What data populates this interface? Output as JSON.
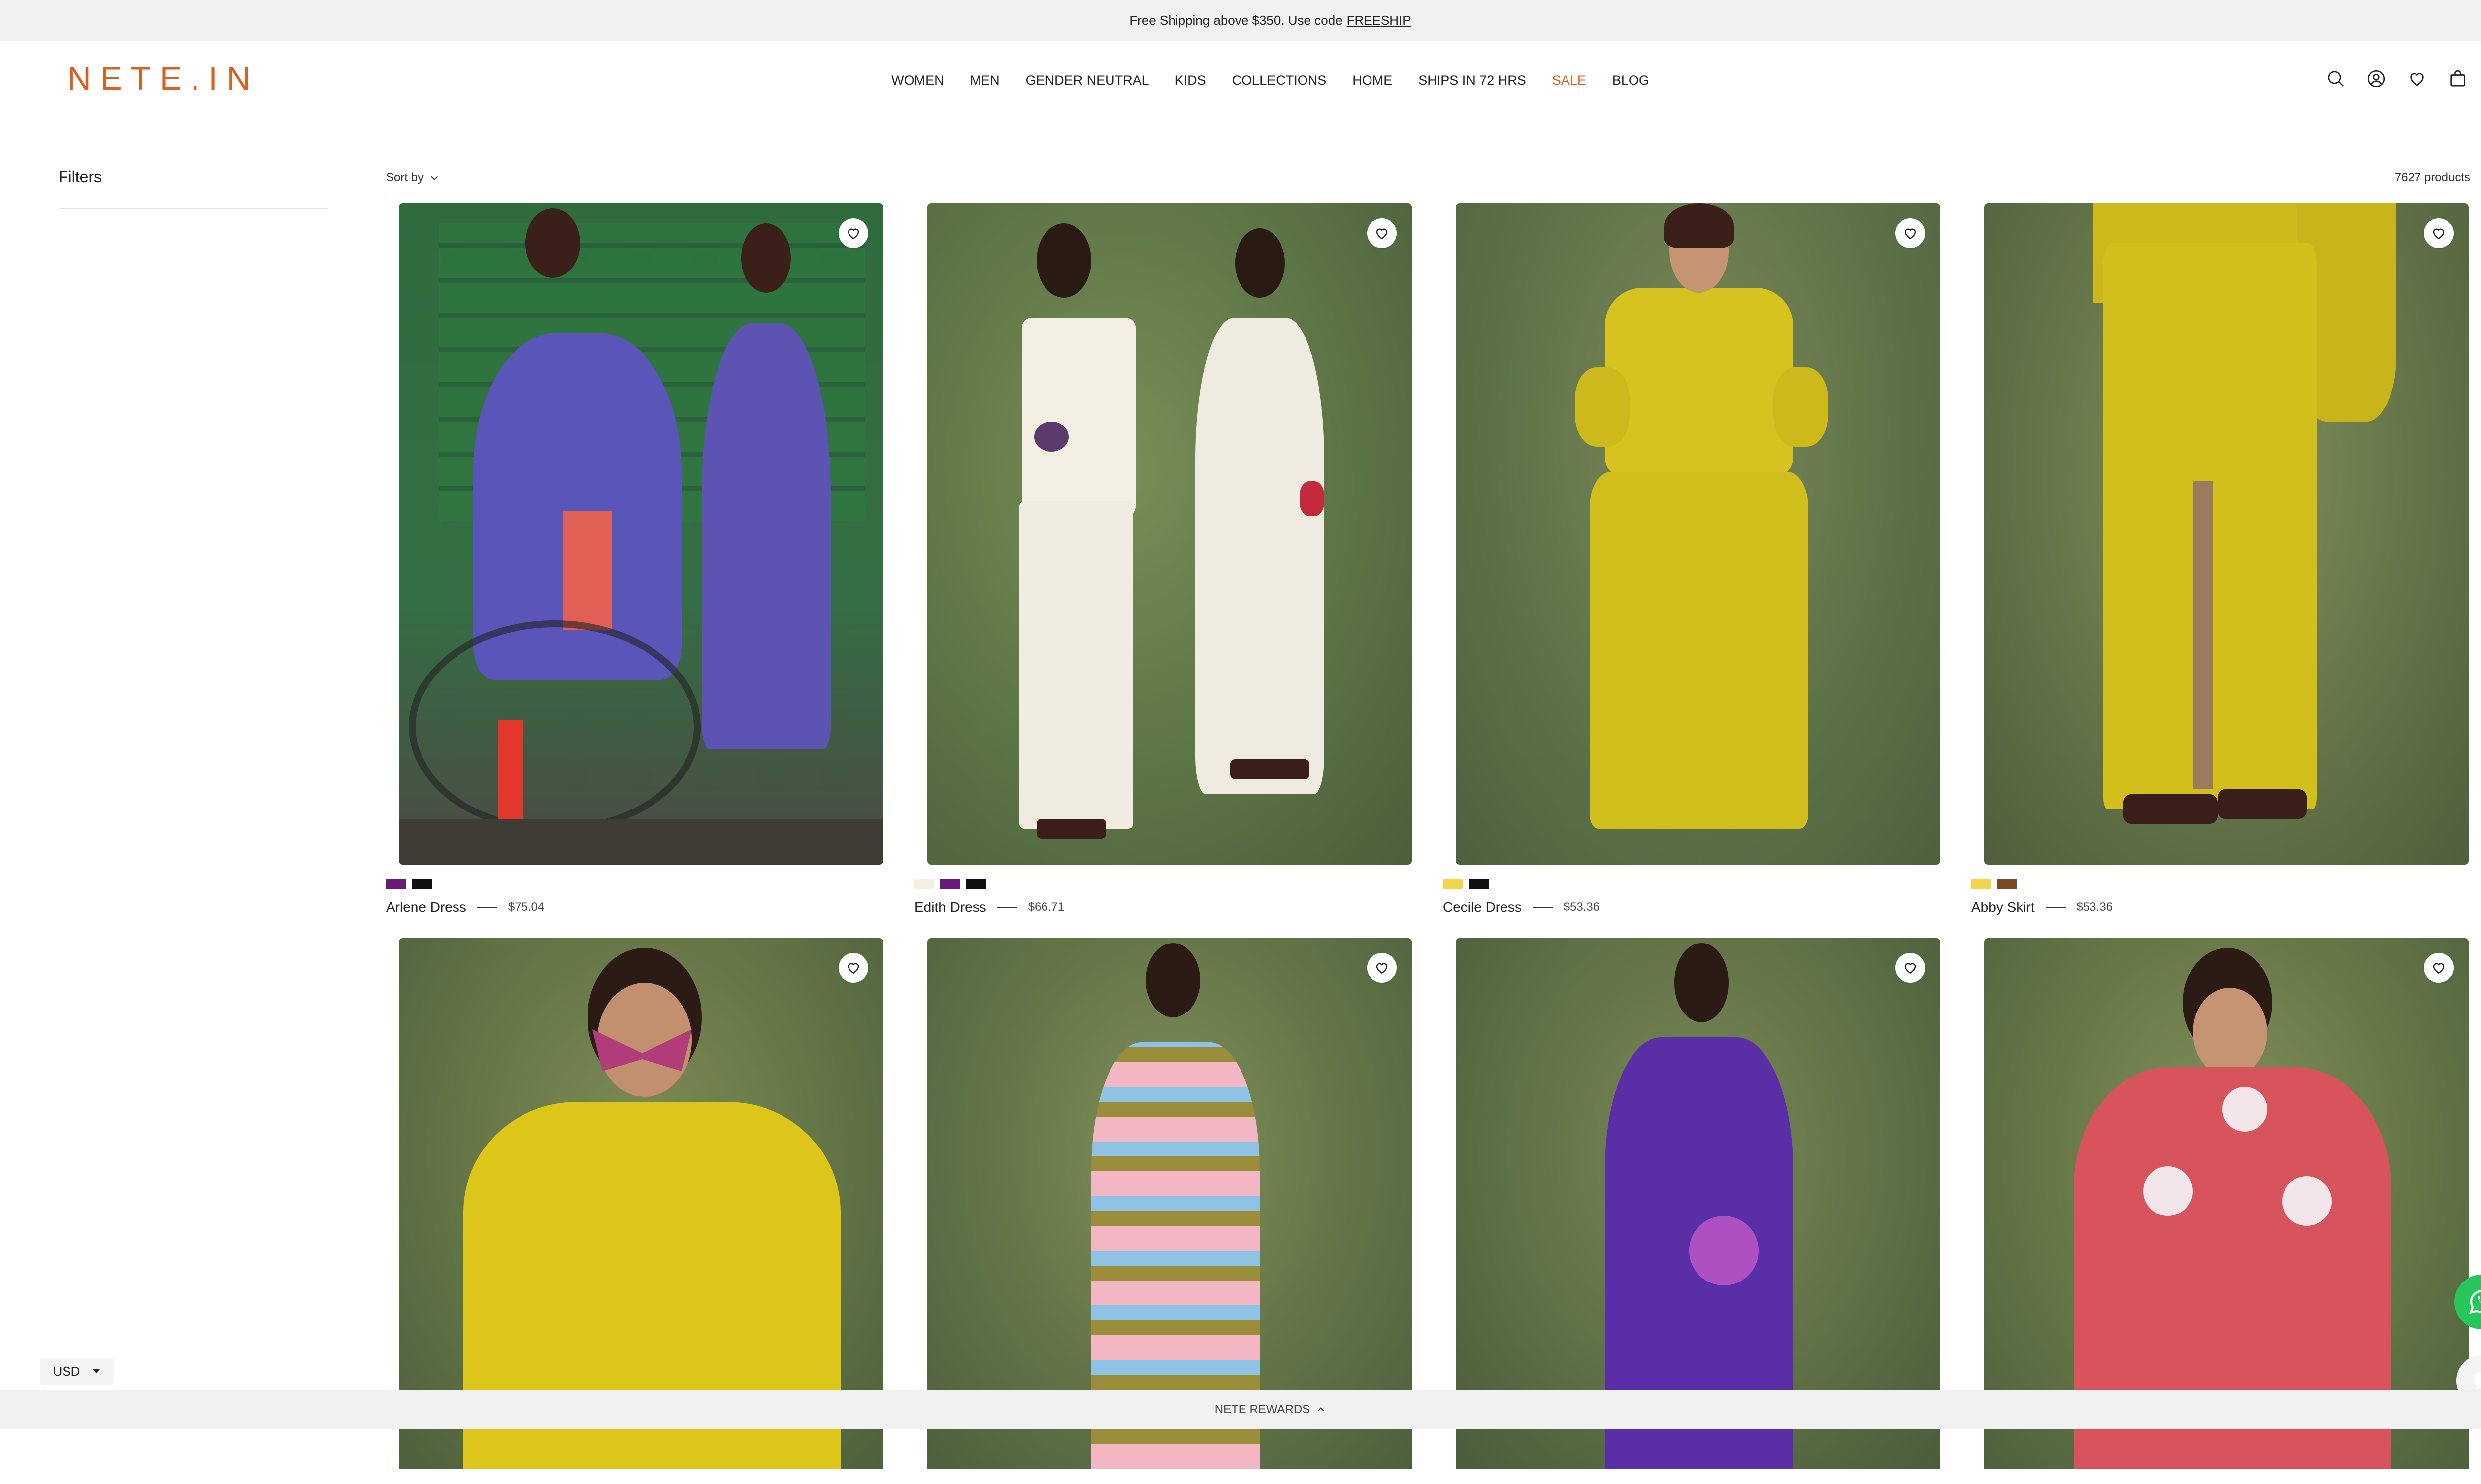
{
  "announcement": {
    "text": "Free Shipping above $350. Use code",
    "code": "FREESHIP"
  },
  "header": {
    "logo": "NETE.IN",
    "nav": [
      "WOMEN",
      "MEN",
      "GENDER NEUTRAL",
      "KIDS",
      "COLLECTIONS",
      "HOME",
      "SHIPS IN 72 HRS",
      "SALE",
      "BLOG"
    ],
    "icons": [
      "search-icon",
      "account-icon",
      "heart-icon",
      "bag-icon"
    ],
    "sale_color": "#e2601f"
  },
  "sidebar": {
    "title": "Filters"
  },
  "toolbar": {
    "sort_label": "Sort by",
    "count": "7627 products"
  },
  "products": [
    {
      "name": "Arlene Dress",
      "price": "$75.04",
      "swatches": [
        "#6a1a78",
        "#111111"
      ]
    },
    {
      "name": "Edith Dress",
      "price": "$66.71",
      "swatches": [
        "#f3efe3",
        "#6a1a78",
        "#111111"
      ]
    },
    {
      "name": "Cecile Dress",
      "price": "$53.36",
      "swatches": [
        "#f1d64b",
        "#111111"
      ]
    },
    {
      "name": "Abby Skirt",
      "price": "$53.36",
      "swatches": [
        "#f1d64b",
        "#7a4a26"
      ]
    }
  ],
  "footer": {
    "rewards": "NETE REWARDS",
    "currency": "USD"
  },
  "colors": {
    "logo": "#d9601f",
    "whatsapp": "#26c65a"
  }
}
